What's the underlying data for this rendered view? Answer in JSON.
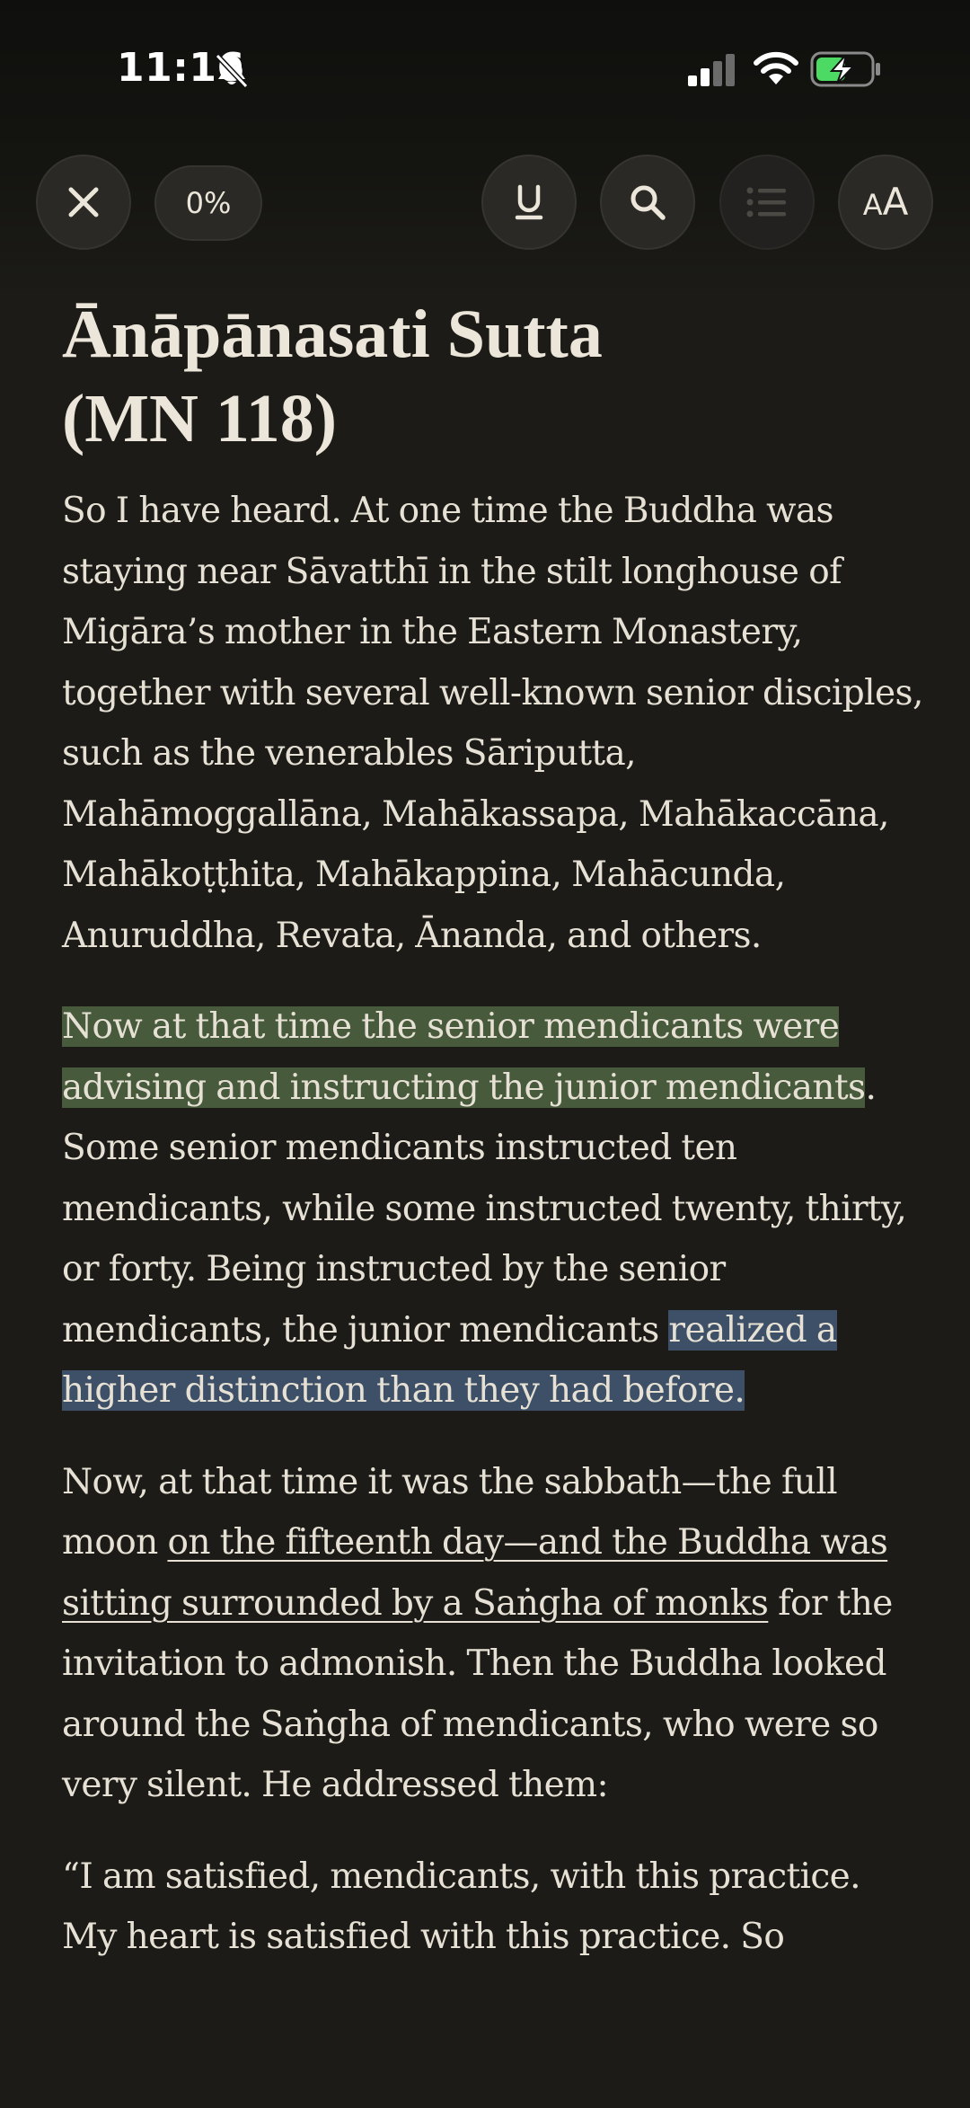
{
  "status_bar": {
    "time": "11:16",
    "icons": [
      "bell-slash-icon",
      "cellular-signal-icon",
      "wifi-icon",
      "battery-charging-icon"
    ],
    "battery_color": "#4cd964"
  },
  "toolbar": {
    "progress": "0%",
    "buttons": [
      "close-icon",
      "underline-icon",
      "search-icon",
      "list-icon",
      "text-size-icon"
    ],
    "aa_small": "A",
    "aa_big": "A"
  },
  "article": {
    "title_line1": "Ānāpānasati Sutta",
    "title_line2": "(MN 118)",
    "p1": "So I have heard. At one time the Buddha was staying near Sāvatthī in the stilt longhouse of Migāra’s mother in the Eastern Monastery, together with several well-known senior disciples, such as the venerables Sāriputta, Mahāmoggallāna, Mahākassapa, Mahākaccāna, Mahākoṭṭhita, Mahākappina, Mahācunda, Anuruddha, Revata, Ānanda, and others.",
    "p2_highlight_green": "Now at that time the senior mendicants were advising and instructing the junior mendicants",
    "p2_middle": ". Some senior mendicants instructed ten mendicants, while some instructed twenty, thirty, or forty. Being instructed by the senior mendicants, the junior mendicants ",
    "p2_highlight_blue": "realized a higher distinction than they had before.",
    "p3_start": "Now, at that time it was the sabbath—the full moon ",
    "p3_underlined": "on the fifteenth day—and the Buddha was sitting surrounded by a Saṅgha of monks",
    "p3_end": " for the invitation to admonish. Then the Buddha looked around the Saṅgha of mendicants, who were so very silent. He addressed them:",
    "p4": "“I am satisfied, mendicants, with this practice. My heart is satisfied with this practice. So"
  },
  "colors": {
    "background": "#1c1b17",
    "text": "#ebe6d9",
    "highlight_green": "#485a3c",
    "highlight_blue": "#3d5068"
  }
}
